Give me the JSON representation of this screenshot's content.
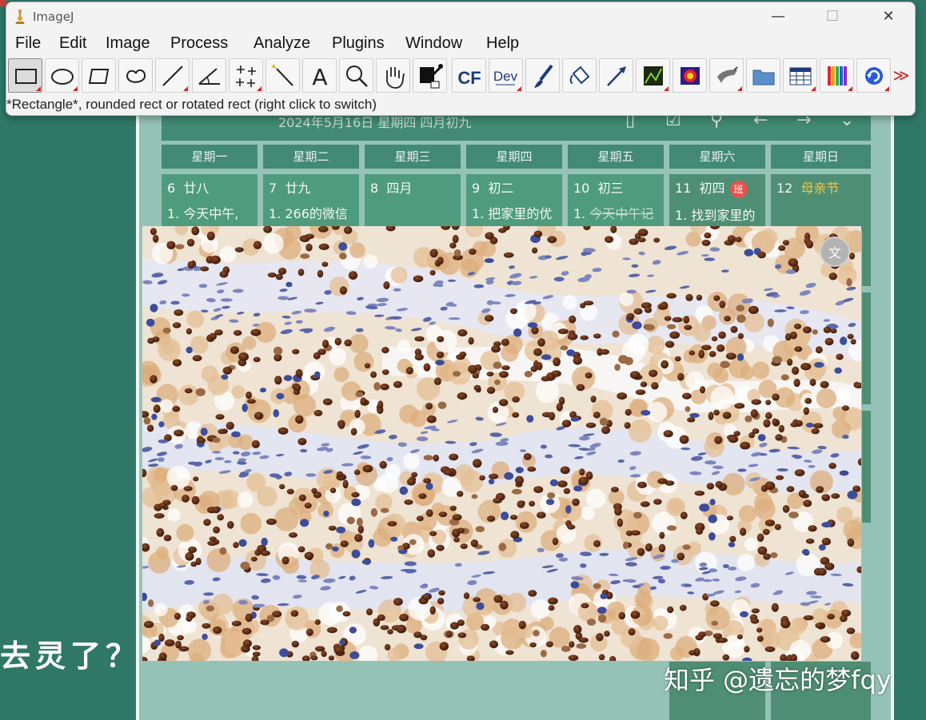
{
  "desktop": {
    "big_text": "去灵了？",
    "watermark": "知乎 @遗忘的梦fqy"
  },
  "calendar": {
    "date_line": "2024年5月16日 星期四 四月初九",
    "header_icons": [
      "phone-icon",
      "check-cloud-icon",
      "person-icon",
      "arrow-left-icon",
      "arrow-right-icon",
      "chevron-down-icon"
    ],
    "weekdays": [
      "星期一",
      "星期二",
      "星期三",
      "星期四",
      "星期五",
      "星期六",
      "星期日"
    ],
    "days": [
      {
        "day": "6",
        "lunar": "廿八",
        "note": "1. 今天中午,"
      },
      {
        "day": "7",
        "lunar": "廿九",
        "note": "1. 266的微信"
      },
      {
        "day": "8",
        "lunar": "四月",
        "note": ""
      },
      {
        "day": "9",
        "lunar": "初二",
        "note": "1. 把家里的优"
      },
      {
        "day": "10",
        "lunar": "初三",
        "note_prefix": "1.",
        "note_struck": "今天中午记"
      },
      {
        "day": "11",
        "lunar": "初四",
        "badge": "班",
        "note": "1. 找到家里的"
      },
      {
        "day": "12",
        "lunar": "母亲节",
        "note": ""
      }
    ],
    "accent_holiday": "#f5c542",
    "accent_badge": "#e6534d"
  },
  "overlay": {
    "translate_icon": "文"
  },
  "imagej": {
    "title": "ImageJ",
    "window_controls": {
      "minimize": "—",
      "maximize": "☐",
      "close": "✕"
    },
    "menu": [
      "File",
      "Edit",
      "Image",
      "Process",
      "Analyze",
      "Plugins",
      "Window",
      "Help"
    ],
    "tools": [
      {
        "name": "rectangle-tool",
        "selected": true,
        "menu": true
      },
      {
        "name": "oval-tool",
        "menu": true
      },
      {
        "name": "polygon-tool"
      },
      {
        "name": "freehand-tool"
      },
      {
        "name": "line-tool",
        "menu": true
      },
      {
        "name": "angle-tool"
      },
      {
        "name": "point-tool",
        "menu": true
      },
      {
        "name": "wand-tool"
      },
      {
        "name": "text-tool",
        "label": "A"
      },
      {
        "name": "magnifier-tool"
      },
      {
        "name": "hand-tool"
      },
      {
        "name": "color-picker-tool"
      },
      {
        "name": "cf-tool",
        "label": "CF"
      },
      {
        "name": "dev-tool",
        "label": "Dev",
        "menu": true
      },
      {
        "name": "brush-tool"
      },
      {
        "name": "flood-fill-tool"
      },
      {
        "name": "arrow-tool"
      },
      {
        "name": "stack-tool",
        "menu": true
      },
      {
        "name": "lut-tool"
      },
      {
        "name": "pencil-tool",
        "menu": true
      },
      {
        "name": "folder-tool"
      },
      {
        "name": "table-tool",
        "menu": true
      },
      {
        "name": "channels-tool",
        "menu": true
      },
      {
        "name": "refresh-tool",
        "menu": true
      },
      {
        "name": "more-tools",
        "label": "≫"
      }
    ],
    "status": "*Rectangle*, rounded rect or rotated rect (right click to switch)"
  }
}
